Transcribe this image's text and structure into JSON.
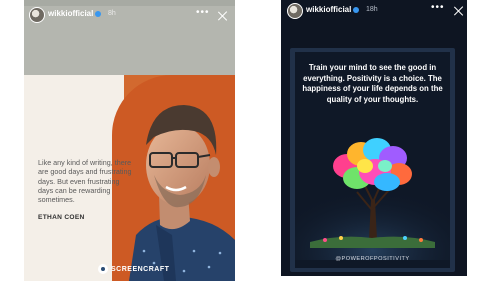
{
  "left_story": {
    "username": "wikkiofficial",
    "time": "8h",
    "more_label": "•••",
    "quote": "Like any kind of writing, there are good days and frustrating days. But even frustrating days can be rewarding sometimes.",
    "author": "ETHAN COEN",
    "brand": "SCREENCRAFT"
  },
  "right_story": {
    "username": "wikkiofficial",
    "time": "18h",
    "more_label": "•••",
    "message": "Train your mind to see the good in everything. Positivity is a choice. The happiness of your life depends on the quality of your thoughts.",
    "handle": "@POWEROFPOSITIVITY"
  },
  "colors": {
    "left_bg": "#b4b6af",
    "quote_orange": "#cd5a24",
    "right_bg": "#0e1522",
    "verified_blue": "#3897f0"
  },
  "icons": [
    "avatar",
    "verified-badge-icon",
    "more-icon",
    "close-icon",
    "screencraft-logo-icon"
  ]
}
